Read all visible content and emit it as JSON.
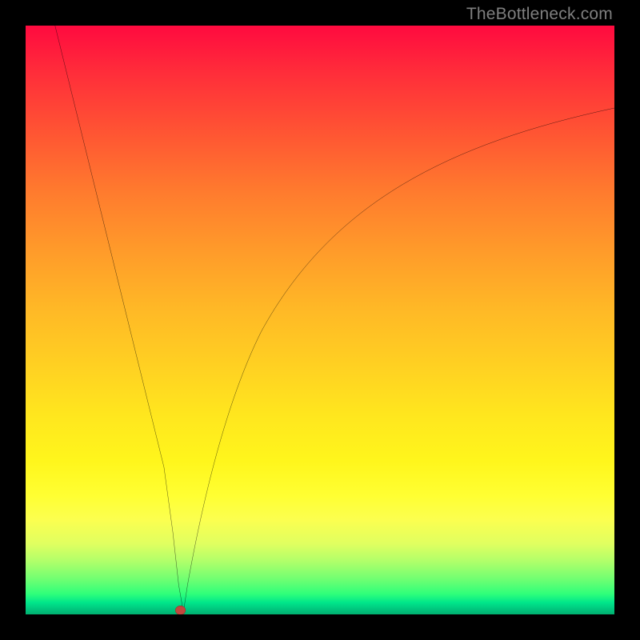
{
  "attribution": "TheBottleneck.com",
  "chart_data": {
    "type": "line",
    "title": "",
    "xlabel": "",
    "ylabel": "",
    "xlim": [
      0,
      100
    ],
    "ylim": [
      0,
      100
    ],
    "notes": "Bottleneck-style curve: steep linear descent from upper-left to a minimum near x≈25, then asymptotic rise toward the right. Background is a vertical gradient red→yellow→green (green at bottom = optimal). A small red marker sits at the curve minimum.",
    "series": [
      {
        "name": "bottleneck-curve",
        "x": [
          5,
          10,
          15,
          20,
          23,
          25,
          26,
          27,
          28,
          30,
          33,
          37,
          42,
          48,
          55,
          62,
          70,
          78,
          86,
          94,
          100
        ],
        "y": [
          100,
          79,
          59,
          38,
          25,
          14,
          5,
          0,
          5,
          17,
          30,
          42,
          52,
          60,
          67,
          72,
          76,
          80,
          83,
          85,
          86
        ]
      }
    ],
    "marker": {
      "x": 26.2,
      "y": 0.5,
      "color": "#c1473e",
      "r": 1.0
    },
    "gradient_stops": [
      {
        "pos": 0,
        "color": "#ff0a3f"
      },
      {
        "pos": 18,
        "color": "#ff5433"
      },
      {
        "pos": 38,
        "color": "#ff9a2a"
      },
      {
        "pos": 58,
        "color": "#ffd122"
      },
      {
        "pos": 80,
        "color": "#ffff33"
      },
      {
        "pos": 94,
        "color": "#70ff72"
      },
      {
        "pos": 100,
        "color": "#00b070"
      }
    ]
  }
}
